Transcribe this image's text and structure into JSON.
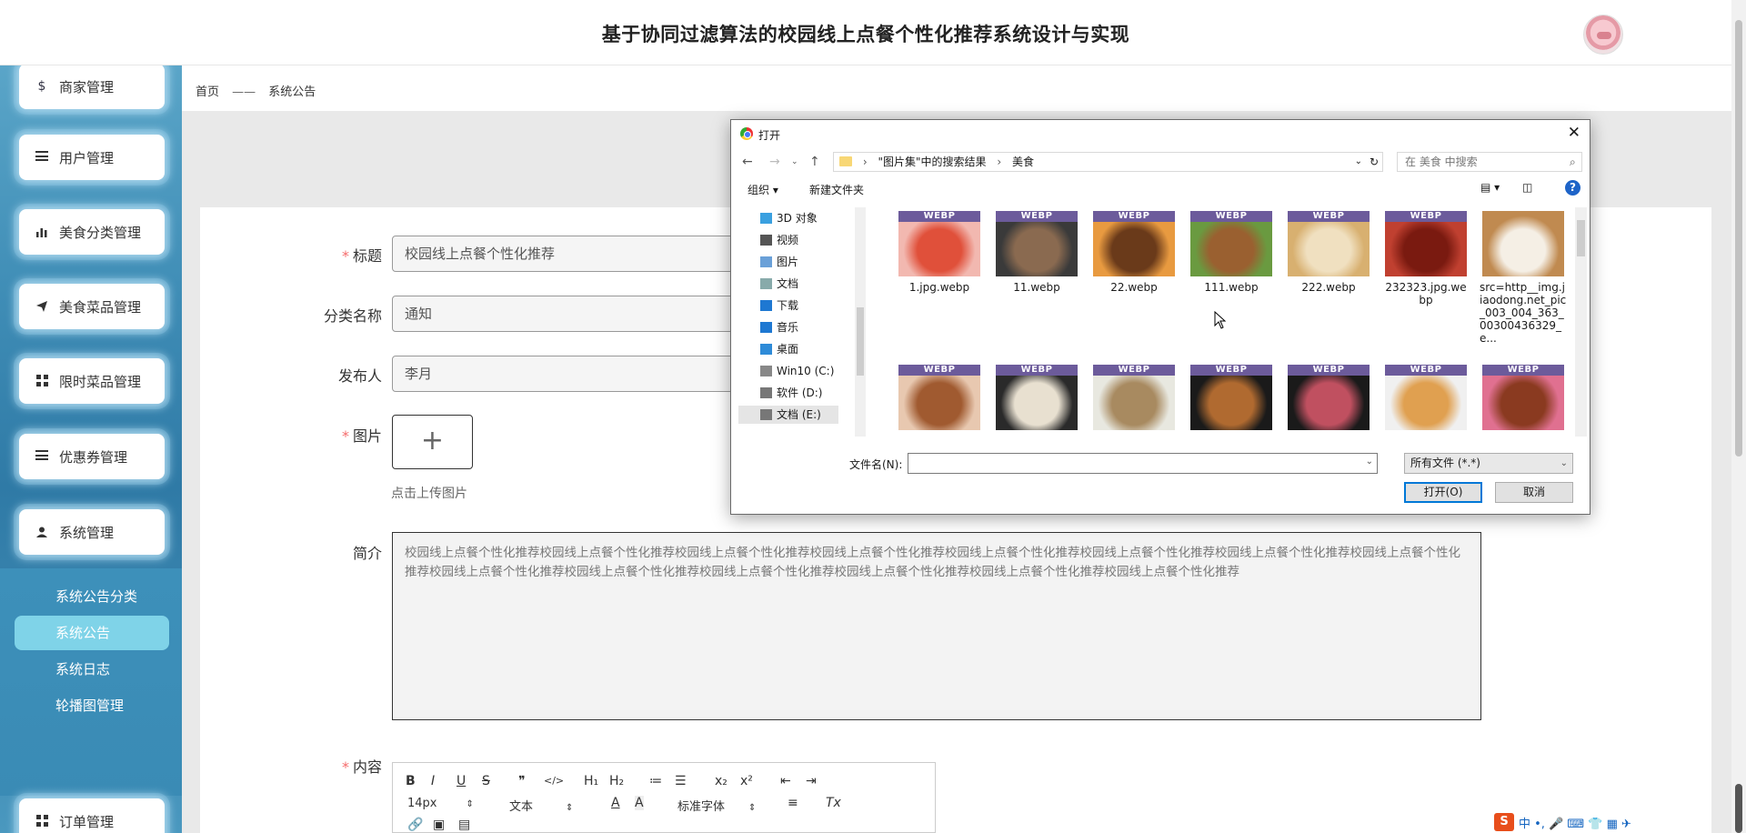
{
  "header": {
    "title": "基于协同过滤算法的校园线上点餐个性化推荐系统设计与实现"
  },
  "sidebar": {
    "items": [
      {
        "label": "商家管理",
        "icon": "dollar-icon"
      },
      {
        "label": "用户管理",
        "icon": "list-icon"
      },
      {
        "label": "美食分类管理",
        "icon": "bar-chart-icon"
      },
      {
        "label": "美食菜品管理",
        "icon": "send-icon"
      },
      {
        "label": "限时菜品管理",
        "icon": "grid-icon"
      },
      {
        "label": "优惠券管理",
        "icon": "list-icon"
      },
      {
        "label": "系统管理",
        "icon": "user-icon"
      },
      {
        "label": "订单管理",
        "icon": "grid-icon"
      }
    ],
    "sub_items": [
      {
        "label": "系统公告分类",
        "active": false
      },
      {
        "label": "系统公告",
        "active": true
      },
      {
        "label": "系统日志",
        "active": false
      },
      {
        "label": "轮播图管理",
        "active": false
      }
    ]
  },
  "breadcrumb": {
    "home": "首页",
    "separator": "——",
    "current": "系统公告"
  },
  "form": {
    "title_label": "标题",
    "title_value": "校园线上点餐个性化推荐",
    "category_label": "分类名称",
    "category_value": "通知",
    "publisher_label": "发布人",
    "publisher_value": "李月",
    "image_label": "图片",
    "upload_plus": "+",
    "upload_tip": "点击上传图片",
    "intro_label": "简介",
    "intro_value": "校园线上点餐个性化推荐校园线上点餐个性化推荐校园线上点餐个性化推荐校园线上点餐个性化推荐校园线上点餐个性化推荐校园线上点餐个性化推荐校园线上点餐个性化推荐校园线上点餐个性化推荐校园线上点餐个性化推荐校园线上点餐个性化推荐校园线上点餐个性化推荐校园线上点餐个性化推荐校园线上点餐个性化推荐校园线上点餐个性化推荐",
    "content_label": "内容",
    "required_mark": "*"
  },
  "editor": {
    "toolbar_row1": [
      "B",
      "I",
      "U",
      "S",
      "❞",
      "</>",
      "H₁",
      "H₂",
      "≔",
      "☰",
      "x₂",
      "x²",
      "⇤",
      "⇥"
    ],
    "font_size": "14px",
    "text_style": "文本",
    "font_family": "标准字体",
    "clear_format": "Tx"
  },
  "dialog": {
    "title": "打开",
    "path_root": "\"图片集\"中的搜索结果",
    "path_current": "美食",
    "search_placeholder": "在 美食 中搜索",
    "organize": "组织 ▾",
    "new_folder": "新建文件夹",
    "help": "?",
    "nav_items": [
      {
        "label": "3D 对象",
        "color": "#3aa0e0"
      },
      {
        "label": "视频",
        "color": "#555"
      },
      {
        "label": "图片",
        "color": "#6aa0d8"
      },
      {
        "label": "文档",
        "color": "#8aa"
      },
      {
        "label": "下载",
        "color": "#1e78d2"
      },
      {
        "label": "音乐",
        "color": "#1e78d2"
      },
      {
        "label": "桌面",
        "color": "#2e8bd8"
      },
      {
        "label": "Win10 (C:)",
        "color": "#888"
      },
      {
        "label": "软件 (D:)",
        "color": "#777"
      },
      {
        "label": "文档 (E:)",
        "color": "#777"
      }
    ],
    "badge": "WEBP",
    "files_row1": [
      {
        "name": "1.jpg.webp",
        "colors": [
          "#f2b8b0",
          "#e0503a"
        ]
      },
      {
        "name": "11.webp",
        "colors": [
          "#3a3a3a",
          "#8a6a50"
        ]
      },
      {
        "name": "22.webp",
        "colors": [
          "#e89a40",
          "#6a3a1a"
        ]
      },
      {
        "name": "111.webp",
        "colors": [
          "#6a9a40",
          "#9a6030"
        ]
      },
      {
        "name": "222.webp",
        "colors": [
          "#d8b070",
          "#f0e0c0"
        ]
      },
      {
        "name": "232323.jpg.webp",
        "colors": [
          "#c04030",
          "#7a1a10"
        ]
      },
      {
        "name": "src=http__img.jiaodong.net_pic_003_004_363_00300436329_e...",
        "colors": [
          "#c08a50",
          "#f5efe5"
        ]
      }
    ],
    "files_row2": [
      {
        "colors": [
          "#e8c8b0",
          "#a05a30"
        ]
      },
      {
        "colors": [
          "#2a2a2a",
          "#e8e0d0"
        ]
      },
      {
        "colors": [
          "#e8e8e0",
          "#a88a60"
        ]
      },
      {
        "colors": [
          "#1a1a1a",
          "#b06a30"
        ]
      },
      {
        "colors": [
          "#1a1a1a",
          "#c05060"
        ]
      },
      {
        "colors": [
          "#f0f0f0",
          "#e0a050"
        ]
      },
      {
        "colors": [
          "#e07090",
          "#8a3a20"
        ]
      }
    ],
    "filename_label": "文件名(N):",
    "filetype": "所有文件 (*.*)",
    "open_button": "打开(O)",
    "cancel_button": "取消"
  },
  "ime": {
    "logo": "S",
    "text": "中 •, 🎤 ⌨ 👕 ▦ ✈"
  }
}
